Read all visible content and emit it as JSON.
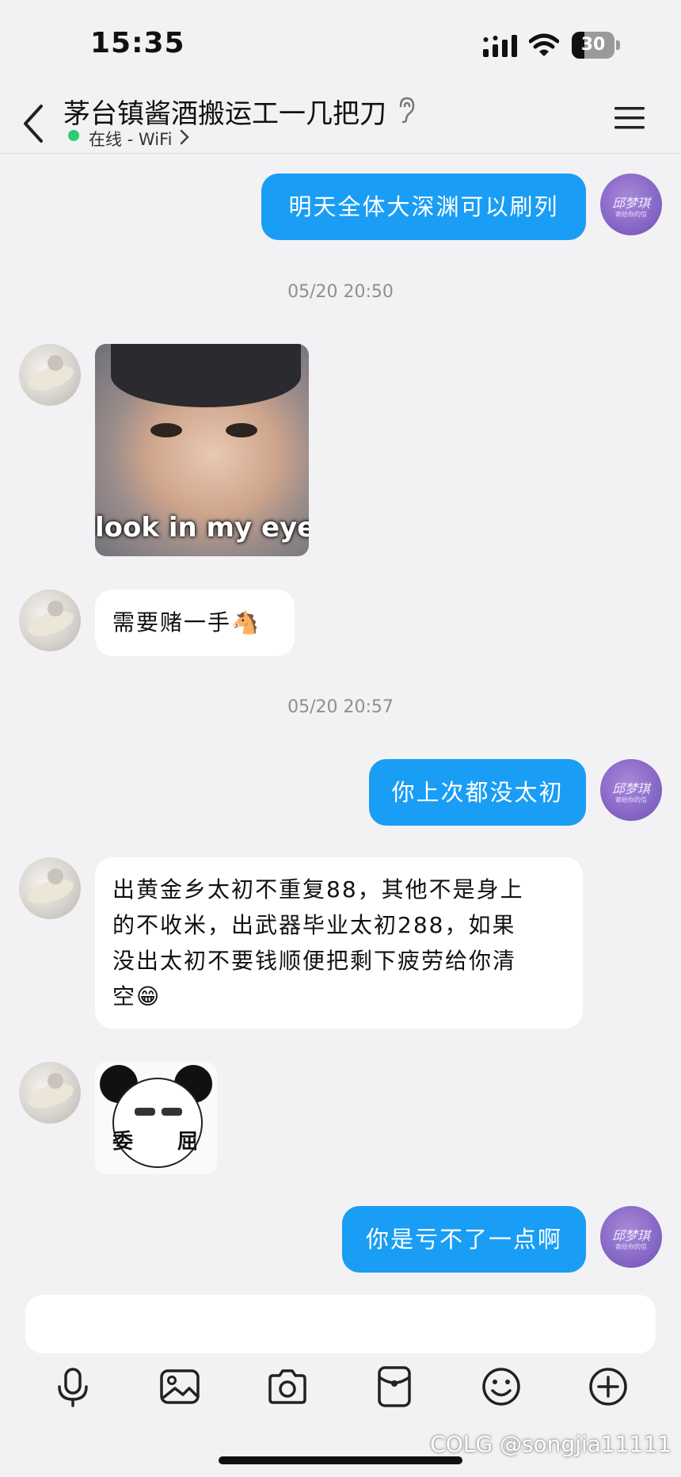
{
  "status_bar": {
    "time": "15:35",
    "battery": "30",
    "battery_level": 0.3
  },
  "header": {
    "title": "茅台镇酱酒搬运工一几把刀",
    "status": "在线 - WiFi"
  },
  "messages": {
    "m1": "明天全体大深渊可以刷列",
    "ts1": "05/20 20:50",
    "meme1_caption": "look in my eyes",
    "m2": "需要赌一手🐴",
    "ts2": "05/20 20:57",
    "m3": "你上次都没太初",
    "m4_lines": [
      "出黄金乡太初不重复88，其他不是身上",
      "的不收米，出武器毕业太初288，如果",
      "没出太初不要钱顺便把剩下疲劳给你清",
      "空😁"
    ],
    "meme2_left": "委",
    "meme2_right": "屈",
    "m5": "你是亏不了一点啊"
  },
  "avatar_right": {
    "signature": "邱梦琪",
    "sub": "寄给你的信"
  },
  "watermark": "COLG @songjia11111",
  "colors": {
    "bubble_blue": "#1a9df4",
    "online_green": "#2ecc71",
    "background": "#f2f2f4"
  },
  "icons": {
    "toolbar": [
      "microphone-icon",
      "image-icon",
      "camera-icon",
      "red-packet-icon",
      "emoji-icon",
      "plus-icon"
    ]
  }
}
